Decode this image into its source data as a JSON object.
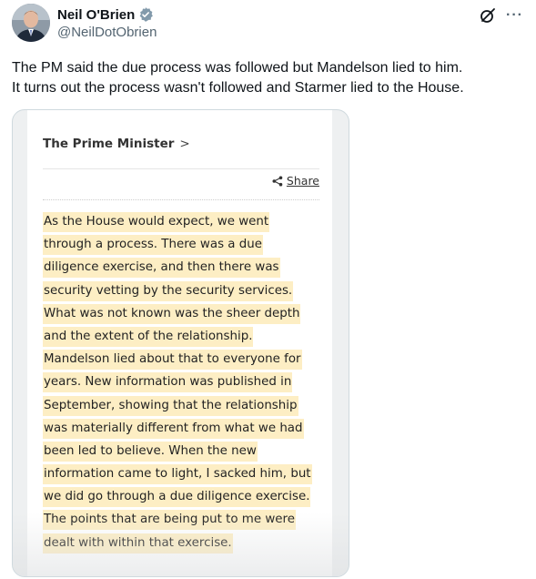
{
  "author": {
    "name": "Neil O'Brien",
    "handle": "@NeilDotObrien"
  },
  "icons": {
    "verified": "verified-badge-icon",
    "grok": "grok-icon",
    "more": "more-icon",
    "share": "share-icon"
  },
  "colors": {
    "verified": "#829aab",
    "highlight": "#fdeec4"
  },
  "tweet": {
    "text_line1": "The PM said the due process was followed but Mandelson lied to him.",
    "text_line2": "It turns out the process wasn't followed and Starmer lied to the House."
  },
  "media": {
    "section_link": "The Prime Minister",
    "chevron": ">",
    "share_label": "Share",
    "quote_lines": [
      "As the House would expect, we went",
      "through a process. There was a due",
      "diligence exercise, and then there was",
      "security vetting by the security services.",
      "What was not known was the sheer depth",
      "and the extent of the relationship.",
      "Mandelson lied about that to everyone for",
      "years. New information was published in",
      "September, showing that the relationship",
      "was materially different from what we had",
      "been led to believe. When the new",
      "information came to light, I sacked him, but",
      "we did go through a due diligence exercise.",
      "The points that are being put to me were",
      "dealt with within that exercise."
    ]
  }
}
